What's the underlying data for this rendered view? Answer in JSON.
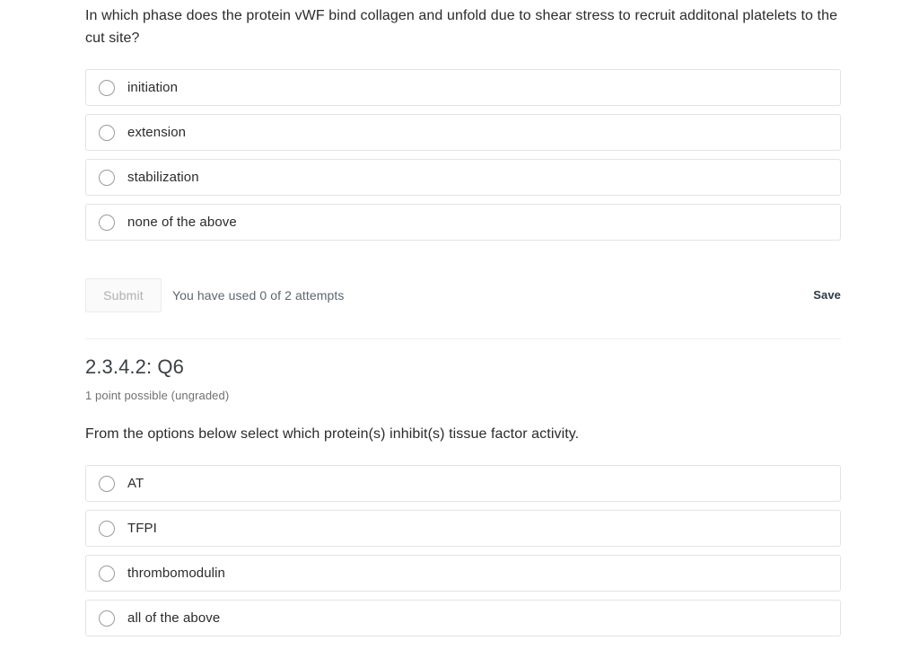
{
  "question1": {
    "prompt": "In which phase does the protein vWF bind collagen and unfold due to shear stress to recruit additonal platelets to the cut site?",
    "options": [
      {
        "label": "initiation"
      },
      {
        "label": "extension"
      },
      {
        "label": "stabilization"
      },
      {
        "label": "none of the above"
      }
    ],
    "submit_label": "Submit",
    "attempts_text": "You have used 0 of 2 attempts",
    "save_label": "Save"
  },
  "question2": {
    "title": "2.3.4.2: Q6",
    "points_text": "1 point possible (ungraded)",
    "prompt": "From the options below select which protein(s) inhibit(s) tissue factor activity.",
    "options": [
      {
        "label": "AT"
      },
      {
        "label": "TFPI"
      },
      {
        "label": "thrombomodulin"
      },
      {
        "label": "all of the above"
      }
    ]
  },
  "colors": {
    "text": "#2b2b2b",
    "muted": "#707070",
    "save_accent": "#2d3b45",
    "border": "#e3e3e3",
    "disabled_button_text": "#b0b0b0"
  }
}
